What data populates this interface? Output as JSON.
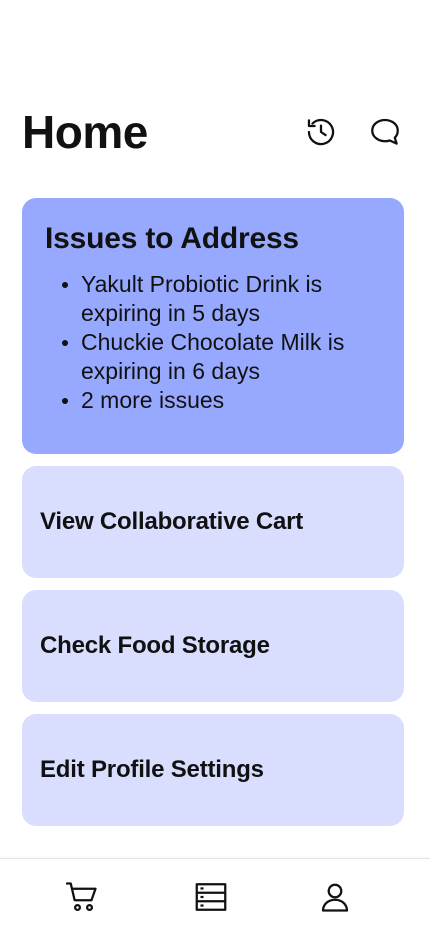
{
  "header": {
    "title": "Home",
    "icons": [
      "history-icon",
      "chat-bubble-icon"
    ]
  },
  "issues": {
    "title": "Issues to Address",
    "items": [
      "Yakult Probiotic Drink is expiring in 5 days",
      "Chuckie Chocolate Milk is expiring in 6 days",
      "2 more issues"
    ]
  },
  "actions": {
    "cart": "View Collaborative Cart",
    "storage": "Check Food Storage",
    "profile": "Edit Profile Settings"
  },
  "nav": {
    "icons": [
      "cart-icon",
      "storage-icon",
      "profile-icon"
    ]
  },
  "colors": {
    "issues_bg": "#97a8ff",
    "card_bg": "#d9deff",
    "text": "#111111"
  }
}
